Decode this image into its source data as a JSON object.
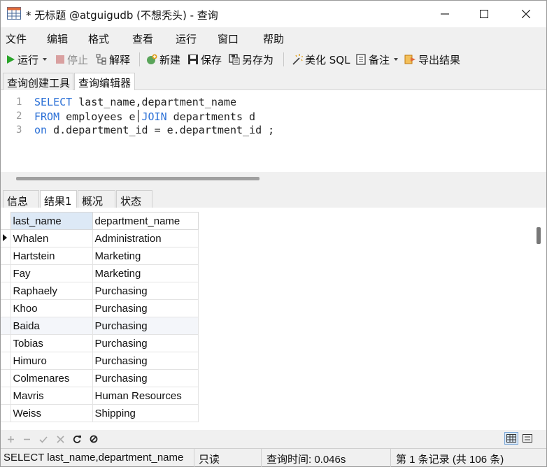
{
  "window": {
    "title": "* 无标题 @atguigudb (不想秃头) - 查询"
  },
  "menu": [
    "文件",
    "编辑",
    "格式",
    "查看",
    "运行",
    "窗口",
    "帮助"
  ],
  "toolbar": {
    "run": "运行",
    "stop": "停止",
    "explain": "解释",
    "new": "新建",
    "save": "保存",
    "save_as": "另存为",
    "beautify": "美化 SQL",
    "comment": "备注",
    "export": "导出结果"
  },
  "editor_tabs": [
    "查询创建工具",
    "查询编辑器"
  ],
  "editor": {
    "line_numbers": [
      "1",
      "2",
      "3"
    ],
    "line1": {
      "kw": "SELECT",
      "text": " last_name,department_name"
    },
    "line2": {
      "kw1": "FROM",
      "text1": " employees e",
      "kw2": "JOIN",
      "text2": " departments d"
    },
    "line3": {
      "kw": "on",
      "text": " d.department_id = e.department_id ;"
    }
  },
  "result_tabs": [
    "信息",
    "结果1",
    "概况",
    "状态"
  ],
  "grid": {
    "columns": [
      "last_name",
      "department_name"
    ],
    "rows": [
      [
        "Whalen",
        "Administration"
      ],
      [
        "Hartstein",
        "Marketing"
      ],
      [
        "Fay",
        "Marketing"
      ],
      [
        "Raphaely",
        "Purchasing"
      ],
      [
        "Khoo",
        "Purchasing"
      ],
      [
        "Baida",
        "Purchasing"
      ],
      [
        "Tobias",
        "Purchasing"
      ],
      [
        "Himuro",
        "Purchasing"
      ],
      [
        "Colmenares",
        "Purchasing"
      ],
      [
        "Mavris",
        "Human Resources"
      ],
      [
        "Weiss",
        "Shipping"
      ]
    ]
  },
  "status": {
    "sql": "SELECT last_name,department_name",
    "mode": "只读",
    "time": "查询时间: 0.046s",
    "records": "第 1 条记录 (共 106 条)"
  },
  "colors": {
    "keyword": "#2a6fd6",
    "run_green": "#2aa52a",
    "header_bg": "#dde9f6"
  }
}
